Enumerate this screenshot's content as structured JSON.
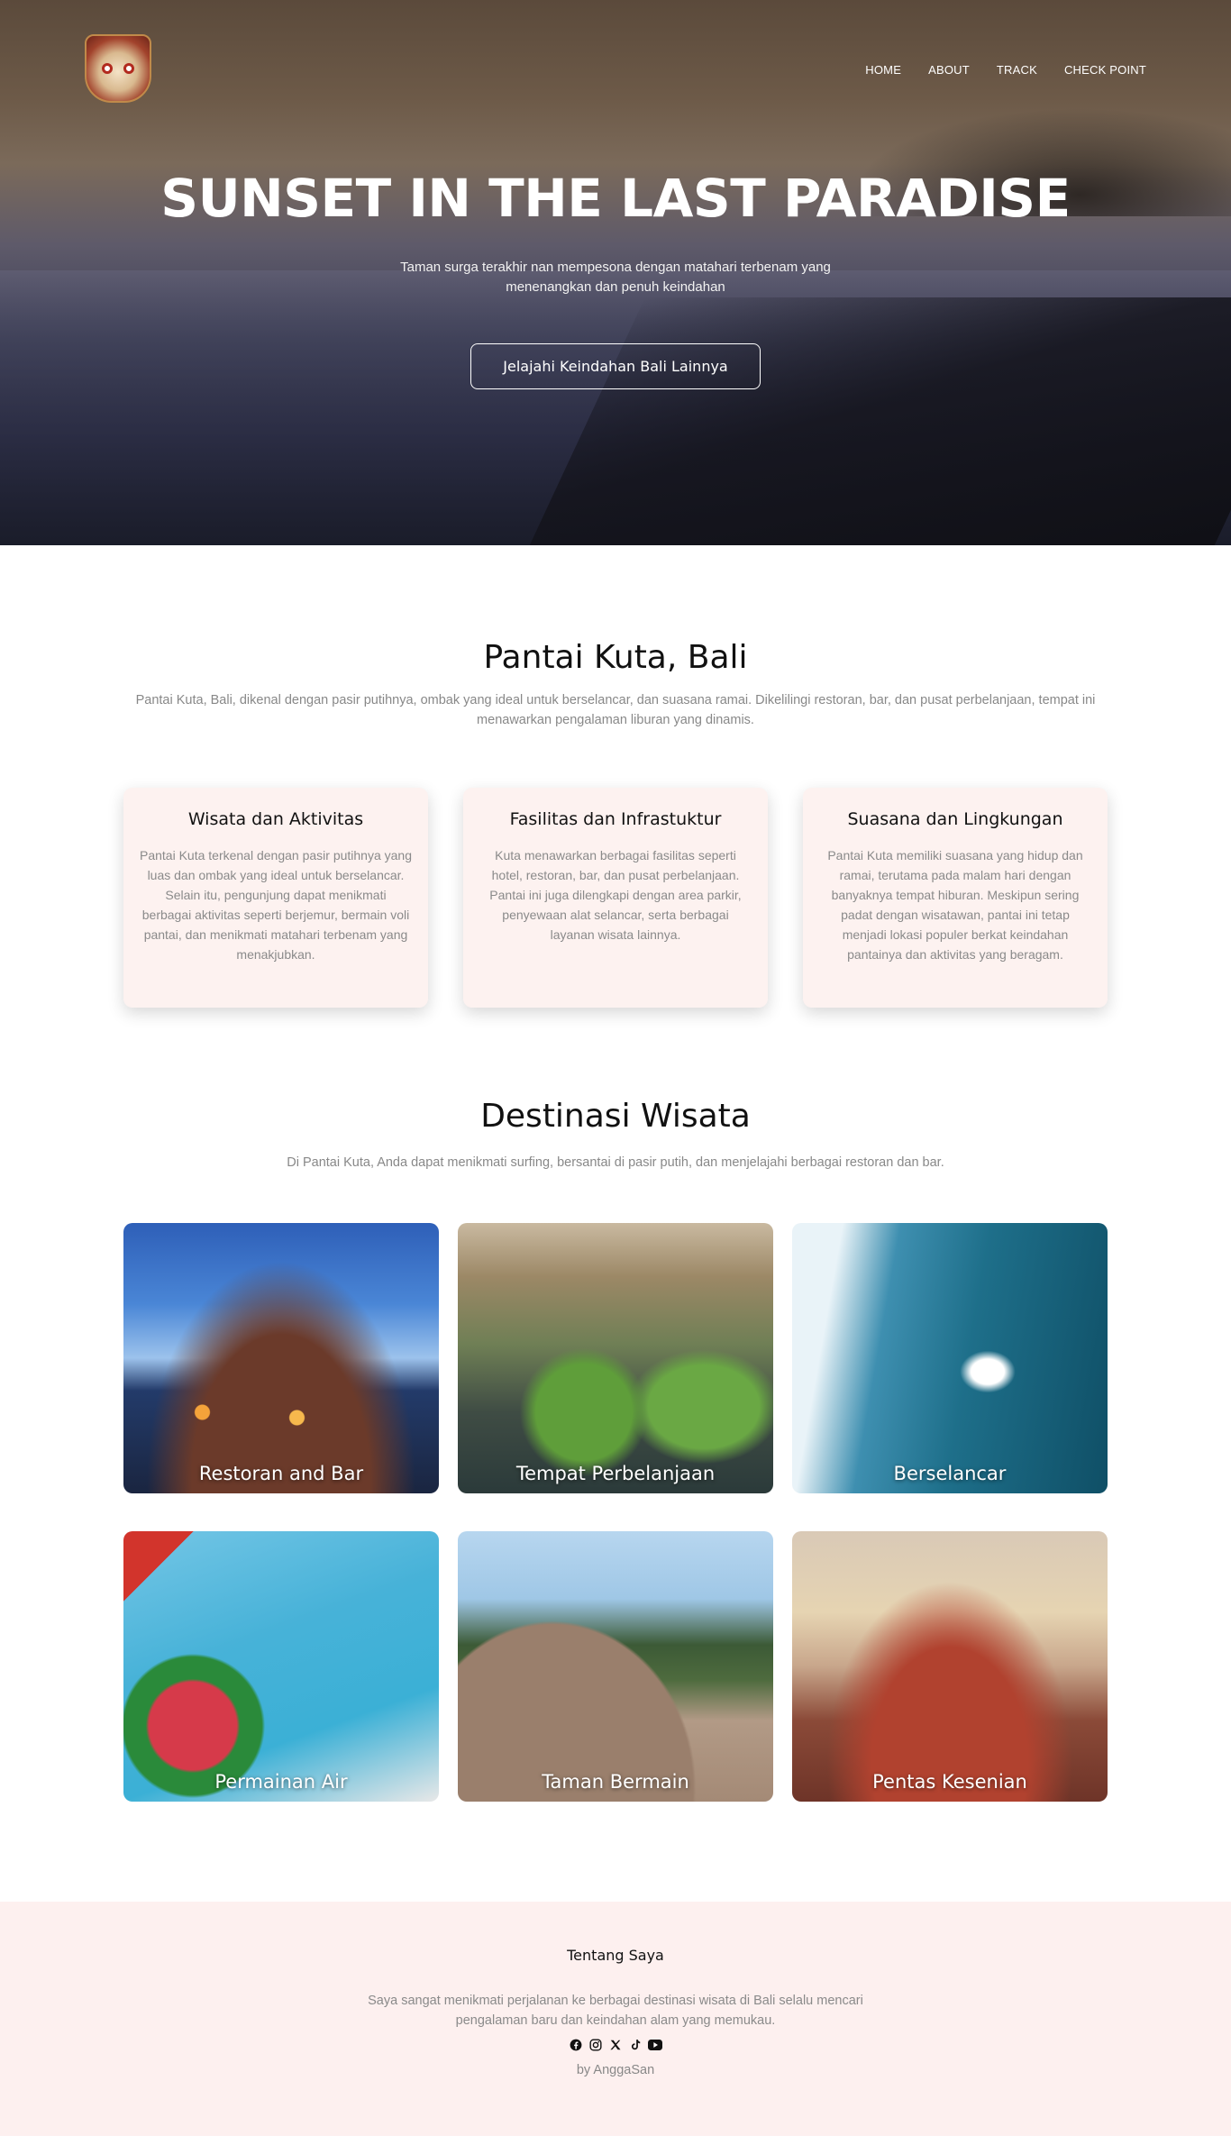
{
  "header": {
    "logo_icon": "barong-mask-logo",
    "nav": [
      {
        "label": "HOME"
      },
      {
        "label": "ABOUT"
      },
      {
        "label": "TRACK"
      },
      {
        "label": "CHECK POINT"
      }
    ]
  },
  "hero": {
    "title": "SUNSET IN THE LAST PARADISE",
    "subtitle": "Taman surga terakhir nan mempesona dengan matahari terbenam yang menenangkan dan penuh keindahan",
    "cta_label": "Jelajahi Keindahan Bali Lainnya"
  },
  "kuta": {
    "title": "Pantai Kuta, Bali",
    "description": "Pantai Kuta, Bali, dikenal dengan pasir putihnya, ombak yang ideal untuk berselancar, dan suasana ramai. Dikelilingi restoran, bar, dan pusat perbelanjaan, tempat ini menawarkan pengalaman liburan yang dinamis.",
    "cards": [
      {
        "title": "Wisata dan Aktivitas",
        "text": "Pantai Kuta terkenal dengan pasir putihnya yang luas dan ombak yang ideal untuk berselancar. Selain itu, pengunjung dapat menikmati berbagai aktivitas seperti berjemur, bermain voli pantai, dan menikmati matahari terbenam yang menakjubkan."
      },
      {
        "title": "Fasilitas dan Infrastuktur",
        "text": "Kuta menawarkan berbagai fasilitas seperti hotel, restoran, bar, dan pusat perbelanjaan. Pantai ini juga dilengkapi dengan area parkir, penyewaan alat selancar, serta berbagai layanan wisata lainnya."
      },
      {
        "title": "Suasana dan Lingkungan",
        "text": "Pantai Kuta memiliki suasana yang hidup dan ramai, terutama pada malam hari dengan banyaknya tempat hiburan. Meskipun sering padat dengan wisatawan, pantai ini tetap menjadi lokasi populer berkat keindahan pantainya dan aktivitas yang beragam."
      }
    ]
  },
  "destinations": {
    "title": "Destinasi Wisata",
    "description": "Di Pantai Kuta, Anda dapat menikmati surfing, bersantai di pasir putih, dan menjelajahi berbagai restoran dan bar.",
    "items": [
      {
        "label": "Restoran and Bar"
      },
      {
        "label": "Tempat Perbelanjaan"
      },
      {
        "label": "Berselancar"
      },
      {
        "label": "Permainan Air"
      },
      {
        "label": "Taman Bermain"
      },
      {
        "label": "Pentas Kesenian"
      }
    ]
  },
  "footer": {
    "title": "Tentang Saya",
    "about": "Saya sangat menikmati perjalanan ke berbagai destinasi wisata di Bali selalu mencari pengalaman baru dan keindahan alam yang memukau.",
    "social_icons": [
      "facebook-icon",
      "instagram-icon",
      "x-twitter-icon",
      "tiktok-icon",
      "youtube-icon"
    ],
    "credit": "by AnggaSan"
  },
  "colors": {
    "card_bg": "#fdf2f0",
    "footer_bg": "#fdf0ef",
    "muted_text": "#888888"
  }
}
